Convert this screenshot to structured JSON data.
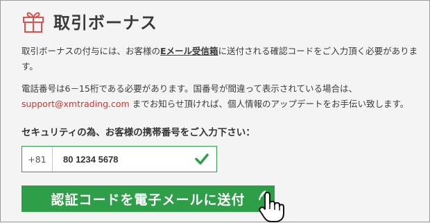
{
  "header": {
    "icon": "gift-icon",
    "title": "取引ボーナス"
  },
  "paragraph1": {
    "before": "取引ボーナスの付与には、お客様の",
    "emphasis": "Eメール受信箱",
    "after": "に送付される確認コードをご入力頂く必要があります。"
  },
  "paragraph2": {
    "line1": "電話番号は6－15桁である必要があります。国番号が間違って表示されている場合は、",
    "email": "support@xmtrading.com",
    "line2": "までお知らせ頂ければ、個人情報のアップデートをお手伝い致します。"
  },
  "phone_form": {
    "prompt": "セキュリティの為、お客様の携帯番号をご入力下さい：",
    "country_code": "+81",
    "phone_number": "80 1234 5678",
    "valid_icon": "check-icon"
  },
  "send_button": {
    "label": "認証コードを電子メールに送付",
    "cursor_icon": "hand-cursor-icon"
  },
  "colors": {
    "accent_green": "#2e9e48",
    "link_red": "#d0342c",
    "icon_red": "#d9534f"
  }
}
